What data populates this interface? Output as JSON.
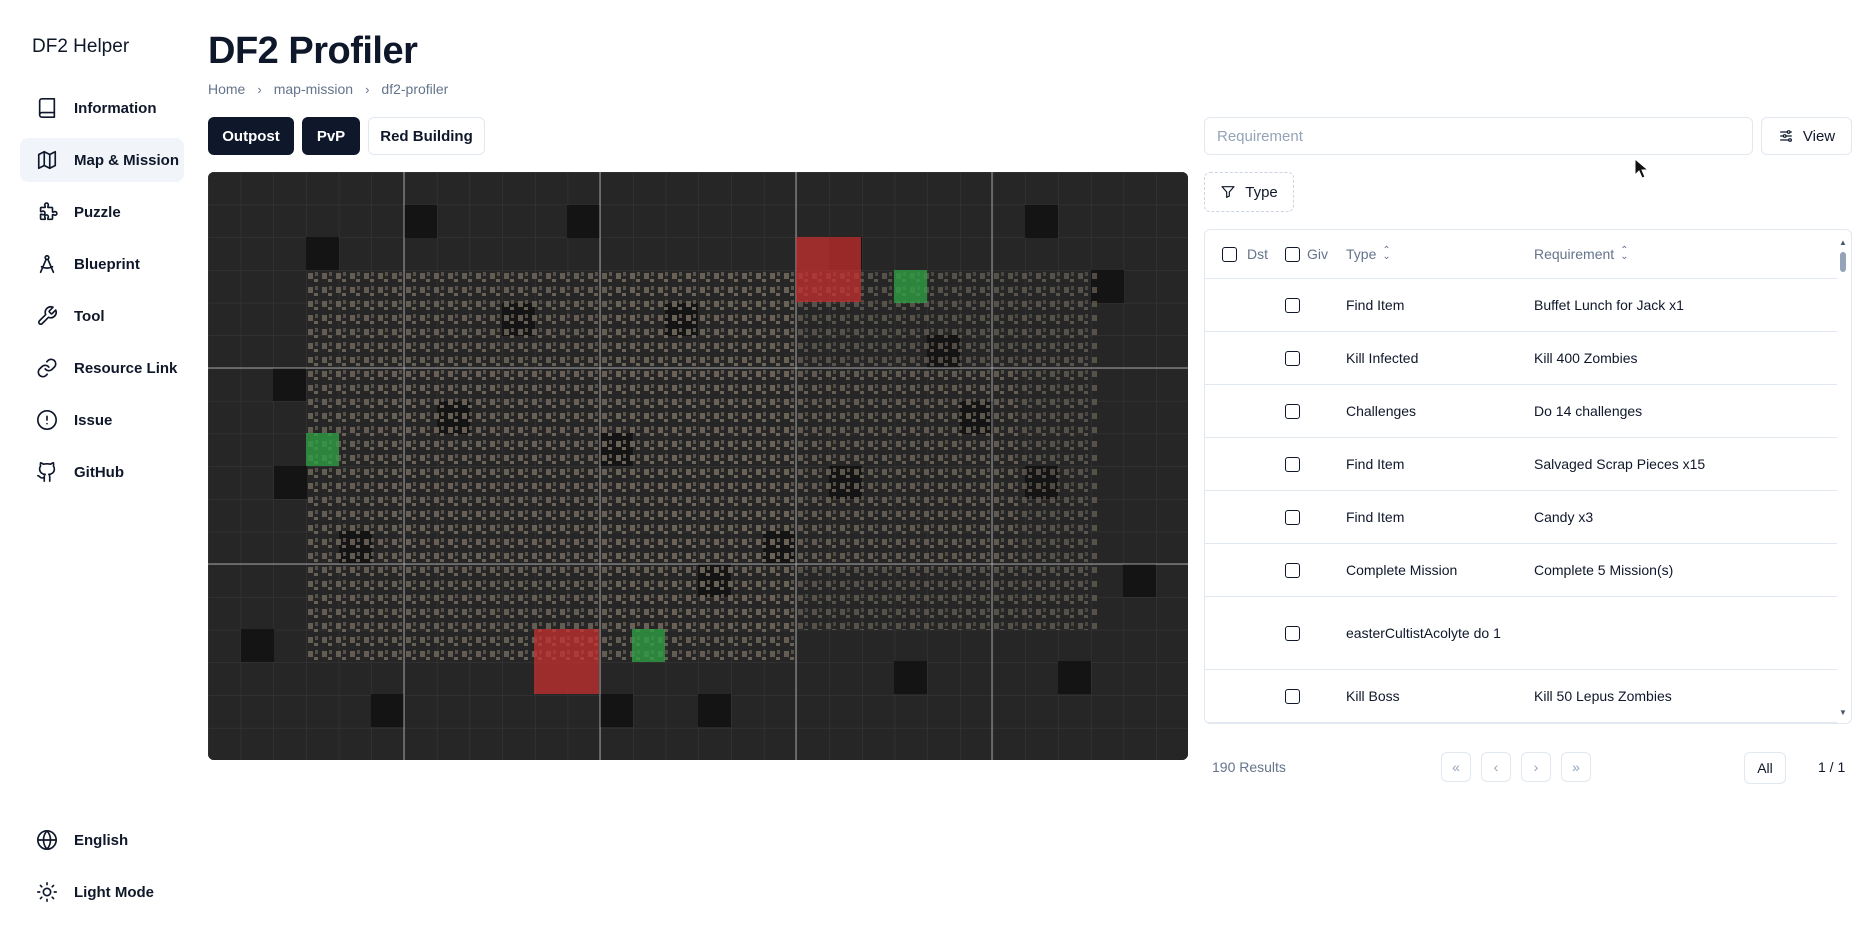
{
  "app": {
    "brand": "DF2 Helper"
  },
  "sidebar": {
    "items": [
      {
        "label": "Information",
        "icon": "book-icon"
      },
      {
        "label": "Map & Mission",
        "icon": "map-icon",
        "active": true
      },
      {
        "label": "Puzzle",
        "icon": "puzzle-icon"
      },
      {
        "label": "Blueprint",
        "icon": "compass-icon"
      },
      {
        "label": "Tool",
        "icon": "wrench-icon"
      },
      {
        "label": "Resource Link",
        "icon": "link-icon"
      },
      {
        "label": "Issue",
        "icon": "alert-circle-icon"
      },
      {
        "label": "GitHub",
        "icon": "github-icon"
      }
    ],
    "footer": [
      {
        "label": "English",
        "icon": "globe-icon"
      },
      {
        "label": "Light Mode",
        "icon": "sun-icon"
      }
    ]
  },
  "header": {
    "title": "DF2 Profiler",
    "breadcrumb": [
      "Home",
      "map-mission",
      "df2-profiler"
    ]
  },
  "toggles": [
    {
      "label": "Outpost",
      "active": true
    },
    {
      "label": "PvP",
      "active": true
    },
    {
      "label": "Red Building",
      "active": false
    }
  ],
  "filters": {
    "search_placeholder": "Requirement",
    "search_value": "",
    "view_label": "View",
    "type_label": "Type"
  },
  "table": {
    "columns": {
      "dst": "Dst",
      "giv": "Giv",
      "type": "Type",
      "requirement": "Requirement"
    },
    "rows": [
      {
        "type": "Find Item",
        "requirement": "Buffet Lunch for Jack x1"
      },
      {
        "type": "Kill Infected",
        "requirement": "Kill 400 Zombies"
      },
      {
        "type": "Challenges",
        "requirement": "Do 14 challenges"
      },
      {
        "type": "Find Item",
        "requirement": "Salvaged Scrap Pieces x15"
      },
      {
        "type": "Find Item",
        "requirement": "Candy x3"
      },
      {
        "type": "Complete Mission",
        "requirement": "Complete 5 Mission(s)"
      },
      {
        "type": "easterCultistAcolyte do 1",
        "requirement": ""
      },
      {
        "type": "Kill Boss",
        "requirement": "Kill 50 Lepus Zombies"
      }
    ]
  },
  "pagination": {
    "results": "190 Results",
    "page_size": "All",
    "page": "1 / 1"
  },
  "colors": {
    "primary": "#0f172a",
    "muted": "#64748b",
    "border": "#e2e8f0",
    "red_zone": "#c53030",
    "green_zone": "#2f9e44"
  }
}
